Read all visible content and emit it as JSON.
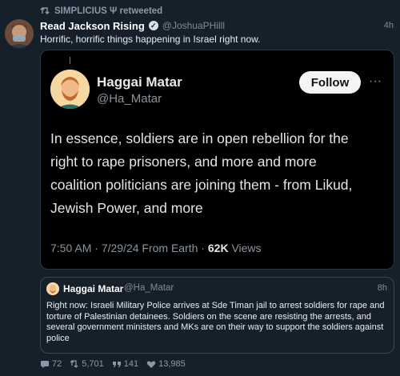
{
  "retweet": {
    "text": "SIMPLICIUS Ψ retweeted"
  },
  "tweet": {
    "name": "Read Jackson Rising",
    "handle": "@JoshuaPHilll",
    "time": "4h",
    "text": "Horrific, horrific things happening in Israel right now."
  },
  "embedded": {
    "name": "Haggai Matar",
    "handle": "@Ha_Matar",
    "follow_label": "Follow",
    "more": "···",
    "lines": [
      "In essence, soldiers are in open rebellion for the",
      "right to rape prisoners, and more and more",
      "coalition politicians are joining them - from Likud,",
      "Jewish Power, and more"
    ],
    "meta_prefix": "7:50 AM · 7/29/24 From Earth · ",
    "views_count": "62K",
    "views_label": " Views"
  },
  "quote": {
    "name": "Haggai Matar",
    "handle": "@Ha_Matar",
    "time": "8h",
    "text": "Right now: Israeli Military Police arrives at Sde Timan jail to arrest soldiers for rape and torture of Palestinian detainees. Soldiers on the scene are resisting the arrests, and several government ministers and MKs are on their way to support the soldiers against police"
  },
  "actions": {
    "replies": "72",
    "retweets": "5,701",
    "quotes": "141",
    "likes": "13,985"
  },
  "colors": {
    "background": "#16202b",
    "muted": "#8b99a6",
    "follow_bg": "#f5f5f5"
  }
}
